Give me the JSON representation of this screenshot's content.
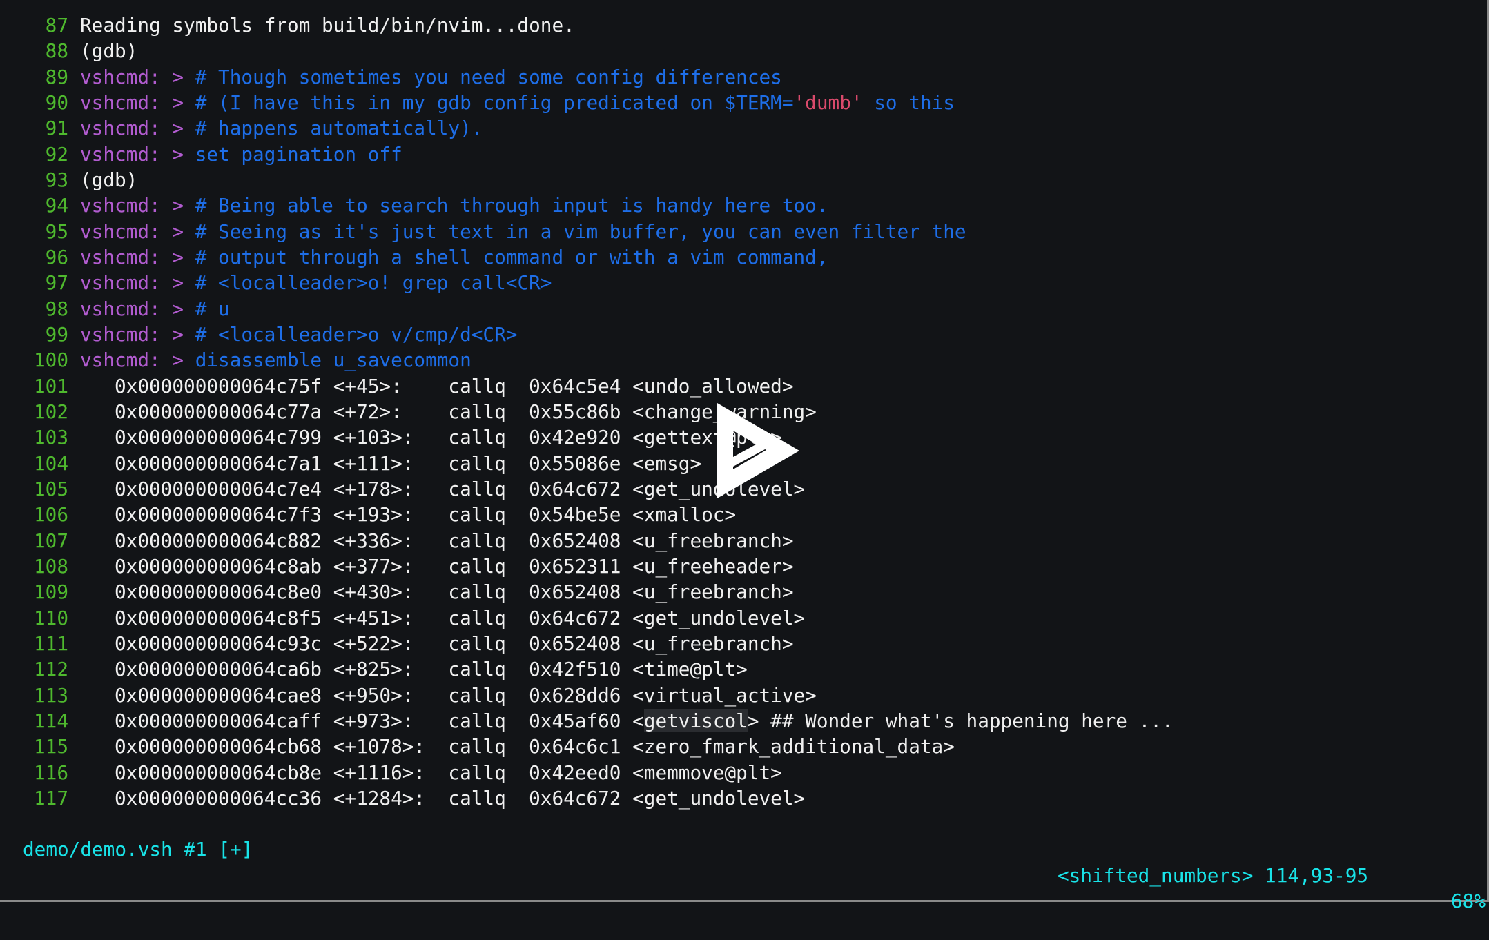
{
  "terminal": {
    "lines": [
      {
        "num": "87",
        "kind": "out",
        "text": "Reading symbols from build/bin/nvim...done."
      },
      {
        "num": "88",
        "kind": "out",
        "text": "(gdb)"
      },
      {
        "num": "89",
        "kind": "cmd",
        "prompt": "vshcmd: > ",
        "text": "# Though sometimes you need some config differences"
      },
      {
        "num": "90",
        "kind": "cmd",
        "prompt": "vshcmd: > ",
        "text": "# (I have this in my gdb config predicated on $TERM=",
        "str": "'dumb'",
        "text_after": " so this"
      },
      {
        "num": "91",
        "kind": "cmd",
        "prompt": "vshcmd: > ",
        "text": "# happens automatically)."
      },
      {
        "num": "92",
        "kind": "cmd",
        "prompt": "vshcmd: > ",
        "text": "set pagination off"
      },
      {
        "num": "93",
        "kind": "out",
        "text": "(gdb)"
      },
      {
        "num": "94",
        "kind": "cmd",
        "prompt": "vshcmd: > ",
        "text": "# Being able to search through input is handy here too."
      },
      {
        "num": "95",
        "kind": "cmd",
        "prompt": "vshcmd: > ",
        "text": "# Seeing as it's just text in a vim buffer, you can even filter the"
      },
      {
        "num": "96",
        "kind": "cmd",
        "prompt": "vshcmd: > ",
        "text": "# output through a shell command or with a vim command,"
      },
      {
        "num": "97",
        "kind": "cmd",
        "prompt": "vshcmd: > ",
        "text": "# <localleader>o! grep call<CR>"
      },
      {
        "num": "98",
        "kind": "cmd",
        "prompt": "vshcmd: > ",
        "text": "# u"
      },
      {
        "num": "99",
        "kind": "cmd",
        "prompt": "vshcmd: > ",
        "text": "# <localleader>o v/cmp/d<CR>"
      },
      {
        "num": "100",
        "kind": "cmd",
        "prompt": "vshcmd: > ",
        "text": "disassemble u_savecommon"
      },
      {
        "num": "101",
        "kind": "out",
        "text": "   0x000000000064c75f <+45>:    callq  0x64c5e4 <undo_allowed>"
      },
      {
        "num": "102",
        "kind": "out",
        "text": "   0x000000000064c77a <+72>:    callq  0x55c86b <change_warning>"
      },
      {
        "num": "103",
        "kind": "out",
        "text": "   0x000000000064c799 <+103>:   callq  0x42e920 <gettext@plt>"
      },
      {
        "num": "104",
        "kind": "out",
        "text": "   0x000000000064c7a1 <+111>:   callq  0x55086e <emsg>"
      },
      {
        "num": "105",
        "kind": "out",
        "text": "   0x000000000064c7e4 <+178>:   callq  0x64c672 <get_undolevel>"
      },
      {
        "num": "106",
        "kind": "out",
        "text": "   0x000000000064c7f3 <+193>:   callq  0x54be5e <xmalloc>"
      },
      {
        "num": "107",
        "kind": "out",
        "text": "   0x000000000064c882 <+336>:   callq  0x652408 <u_freebranch>"
      },
      {
        "num": "108",
        "kind": "out",
        "text": "   0x000000000064c8ab <+377>:   callq  0x652311 <u_freeheader>"
      },
      {
        "num": "109",
        "kind": "out",
        "text": "   0x000000000064c8e0 <+430>:   callq  0x652408 <u_freebranch>"
      },
      {
        "num": "110",
        "kind": "out",
        "text": "   0x000000000064c8f5 <+451>:   callq  0x64c672 <get_undolevel>"
      },
      {
        "num": "111",
        "kind": "out",
        "text": "   0x000000000064c93c <+522>:   callq  0x652408 <u_freebranch>"
      },
      {
        "num": "112",
        "kind": "out",
        "text": "   0x000000000064ca6b <+825>:   callq  0x42f510 <time@plt>"
      },
      {
        "num": "113",
        "kind": "out",
        "text": "   0x000000000064cae8 <+950>:   callq  0x628dd6 <virtual_active>"
      },
      {
        "num": "114",
        "kind": "out",
        "text": "   0x000000000064caff <+973>:   callq  0x45af60 <",
        "hl": "getviscol",
        "text_after": "> ## Wonder what's happening here ..."
      },
      {
        "num": "115",
        "kind": "out",
        "text": "   0x000000000064cb68 <+1078>:  callq  0x64c6c1 <zero_fmark_additional_data>"
      },
      {
        "num": "116",
        "kind": "out",
        "text": "   0x000000000064cb8e <+1116>:  callq  0x42eed0 <memmove@plt>"
      },
      {
        "num": "117",
        "kind": "out",
        "text": "   0x000000000064cc36 <+1284>:  callq  0x64c672 <get_undolevel>"
      }
    ]
  },
  "statusline": {
    "file": "demo/demo.vsh #1 [+]",
    "mode_info": "<shifted_numbers> 114,93-95",
    "percent": "68%"
  },
  "player": {
    "icon": "play-icon"
  },
  "colors": {
    "background": "#121417",
    "line_number": "#4fb92e",
    "prompt": "#b25cd0",
    "command": "#1e6ee8",
    "string": "#d94a6b",
    "output": "#f0f0f0",
    "statusline": "#19e3e8"
  }
}
